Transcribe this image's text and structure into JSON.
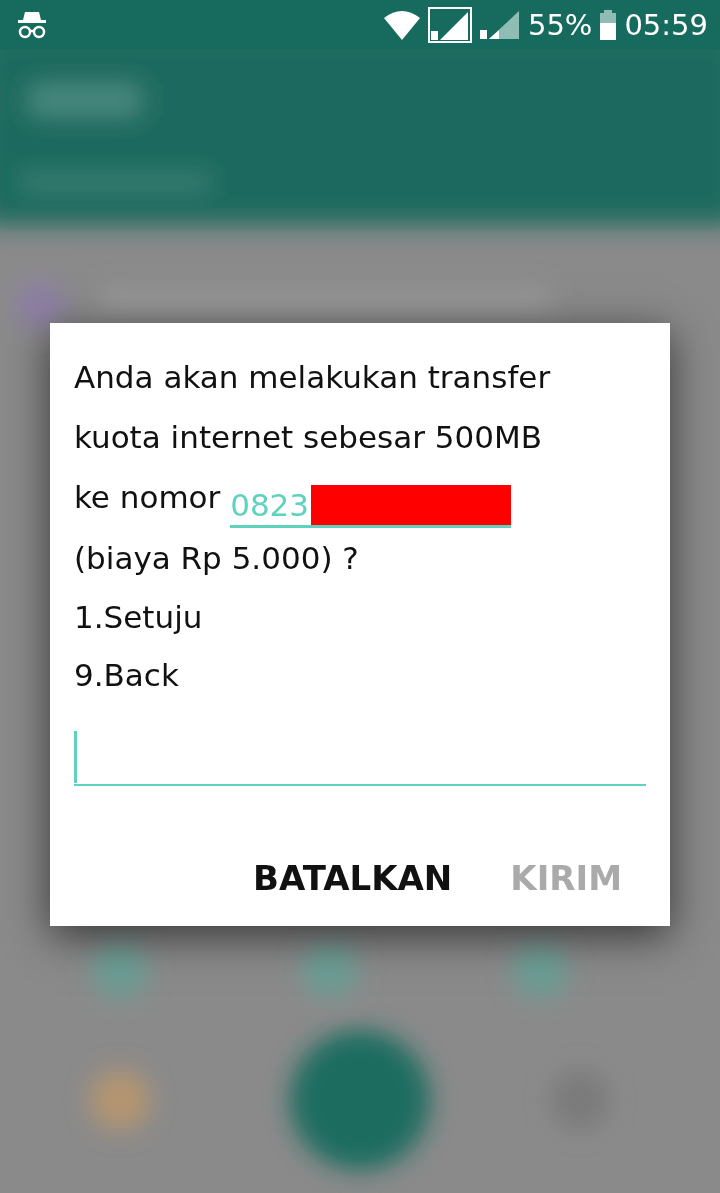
{
  "status_bar": {
    "battery": "55%",
    "time": "05:59"
  },
  "dialog": {
    "message": {
      "text": "Anda akan melakukan transfer\nkuota internet sebesar 500MB\nke nomor ",
      "number": "0823",
      "after": "(biaya Rp 5.000) ?"
    },
    "options": [
      "1.Setuju",
      "9.Back"
    ],
    "input": {
      "focused": true
    },
    "buttons": [
      {
        "label": "BATALKAN",
        "disabled": false
      },
      {
        "label": "KIRIM",
        "disabled": true
      }
    ]
  }
}
